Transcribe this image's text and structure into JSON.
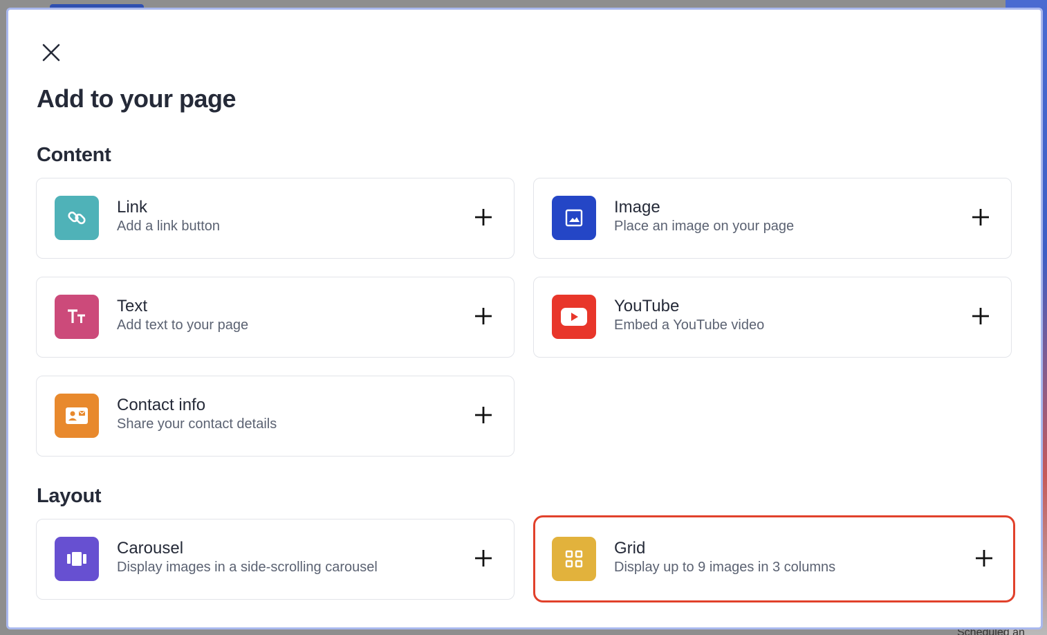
{
  "modal": {
    "title": "Add to your page",
    "close_label": "Close"
  },
  "sections": {
    "content": "Content",
    "layout": "Layout"
  },
  "cards": {
    "link": {
      "title": "Link",
      "desc": "Add a link button",
      "icon": "link-icon",
      "color": "#4fb2b8"
    },
    "image": {
      "title": "Image",
      "desc": "Place an image on your page",
      "icon": "image-icon",
      "color": "#2446c6"
    },
    "text": {
      "title": "Text",
      "desc": "Add text to your page",
      "icon": "text-icon",
      "color": "#cc4a7a"
    },
    "youtube": {
      "title": "YouTube",
      "desc": "Embed a YouTube video",
      "icon": "youtube-icon",
      "color": "#e8362a"
    },
    "contact": {
      "title": "Contact info",
      "desc": "Share your contact details",
      "icon": "contact-card-icon",
      "color": "#e8892d"
    },
    "carousel": {
      "title": "Carousel",
      "desc": "Display images in a side-scrolling carousel",
      "icon": "carousel-icon",
      "color": "#6750d1"
    },
    "grid": {
      "title": "Grid",
      "desc": "Display up to 9 images in 3 columns",
      "icon": "grid-icon",
      "color": "#e2b23c",
      "highlighted": true
    }
  },
  "background": {
    "bottom_text": "Scheduled an"
  },
  "colors": {
    "highlight_border": "#e1412b",
    "modal_border": "#a9b8ee"
  }
}
